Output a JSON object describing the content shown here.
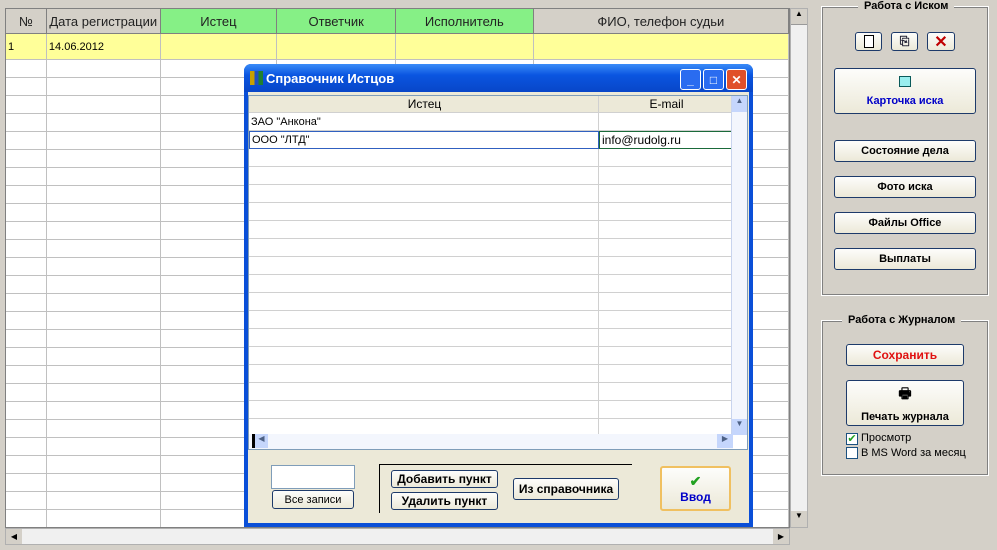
{
  "journal": {
    "columns": [
      "№",
      "Дата регистрации",
      "Истец",
      "Ответчик",
      "Исполнитель",
      "ФИО, телефон судьи"
    ],
    "rows": [
      {
        "num": "1",
        "date": "14.06.2012",
        "plaintiff": "",
        "defendant": "",
        "executor": "",
        "judge": ""
      }
    ]
  },
  "dialog": {
    "title": "Справочник Истцов",
    "columns": [
      "Истец",
      "E-mail"
    ],
    "rows": [
      {
        "name": "ЗАО \"Анкона\"",
        "email": ""
      },
      {
        "name": "ООО \"ЛТД\"",
        "email": "info@rudolg.ru"
      }
    ],
    "filter_value": "",
    "all_records": "Все записи",
    "add_item": "Добавить пункт",
    "delete_item": "Удалить пункт",
    "from_directory": "Из справочника",
    "enter": "Ввод"
  },
  "panel": {
    "claim_group": "Работа с Иском",
    "claim_card": "Карточка иска",
    "case_status": "Состояние дела",
    "claim_photo": "Фото иска",
    "office_files": "Файлы Office",
    "payments": "Выплаты",
    "journal_group": "Работа с Журналом",
    "save": "Сохранить",
    "print_journal": "Печать журнала",
    "preview": "Просмотр",
    "preview_checked": true,
    "msword": "В MS Word за месяц",
    "msword_checked": false
  }
}
